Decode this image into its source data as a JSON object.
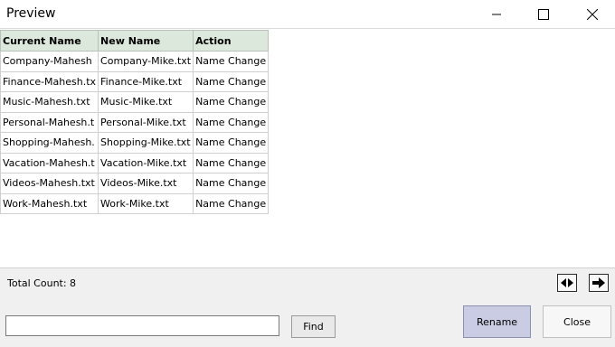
{
  "window": {
    "title": "Preview",
    "controls": [
      "minimize-icon",
      "maximize-icon",
      "close-icon"
    ]
  },
  "table": {
    "headers": [
      "Current Name",
      "New Name",
      "Action"
    ],
    "rows": [
      [
        "Company-Mahesh",
        "Company-Mike.txt",
        "Name Change"
      ],
      [
        "Finance-Mahesh.tx",
        "Finance-Mike.txt",
        "Name Change"
      ],
      [
        "Music-Mahesh.txt",
        "Music-Mike.txt",
        "Name Change"
      ],
      [
        "Personal-Mahesh.t",
        "Personal-Mike.txt",
        "Name Change"
      ],
      [
        "Shopping-Mahesh.",
        "Shopping-Mike.txt",
        "Name Change"
      ],
      [
        "Vacation-Mahesh.t",
        "Vacation-Mike.txt",
        "Name Change"
      ],
      [
        "Videos-Mahesh.txt",
        "Videos-Mike.txt",
        "Name Change"
      ],
      [
        "Work-Mahesh.txt",
        "Work-Mike.txt",
        "Name Change"
      ]
    ]
  },
  "footer": {
    "total_count": "Total Count: 8",
    "search_value": "",
    "find_label": "Find",
    "rename_label": "Rename",
    "close_label": "Close",
    "nav_icons": [
      "resize-columns-icon",
      "arrow-right-icon"
    ]
  },
  "colors": {
    "header_bg": "#dde8dd",
    "rename_bg": "#c9cce3"
  }
}
